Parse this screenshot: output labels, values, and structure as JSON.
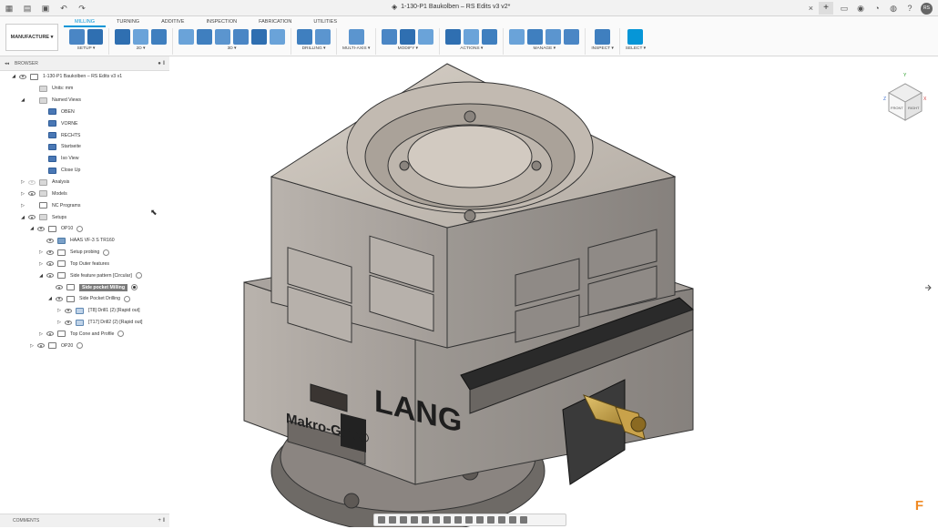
{
  "titlebar": {
    "document_title": "1-130-P1 Baukolben – RS Edits v3 v2*",
    "user_initials": "RS",
    "close_glyph": "×",
    "new_tab_glyph": "+"
  },
  "ribbon": {
    "workspace": "MANUFACTURE ▾",
    "tabs": [
      {
        "label": "MILLING",
        "active": true
      },
      {
        "label": "TURNING",
        "active": false
      },
      {
        "label": "ADDITIVE",
        "active": false
      },
      {
        "label": "INSPECTION",
        "active": false
      },
      {
        "label": "FABRICATION",
        "active": false
      },
      {
        "label": "UTILITIES",
        "active": false
      }
    ],
    "groups": [
      {
        "label": "SETUP ▾",
        "icons": 2
      },
      {
        "label": "2D ▾",
        "icons": 3
      },
      {
        "label": "3D ▾",
        "icons": 6
      },
      {
        "label": "DRILLING ▾",
        "icons": 2
      },
      {
        "label": "MULTI-AXIS ▾",
        "icons": 1
      },
      {
        "label": "MODIFY ▾",
        "icons": 3
      },
      {
        "label": "ACTIONS ▾",
        "icons": 3
      },
      {
        "label": "MANAGE ▾",
        "icons": 4
      },
      {
        "label": "INSPECT ▾",
        "icons": 1
      },
      {
        "label": "SELECT ▾",
        "icons": 1
      }
    ]
  },
  "browser": {
    "title": "BROWSER",
    "items": [
      {
        "label": "1-130-P1 Baukolben – RS Edits v3 v1",
        "indent": 0,
        "arrow": "◢",
        "eye": true,
        "icon": "setup"
      },
      {
        "label": "Units: mm",
        "indent": 1,
        "arrow": "",
        "eye": false,
        "icon": "folder"
      },
      {
        "label": "Named Views",
        "indent": 1,
        "arrow": "◢",
        "eye": false,
        "icon": "folder"
      },
      {
        "label": "OBEN",
        "indent": 2,
        "arrow": "",
        "eye": false,
        "icon": "view"
      },
      {
        "label": "VORNE",
        "indent": 2,
        "arrow": "",
        "eye": false,
        "icon": "view"
      },
      {
        "label": "RECHTS",
        "indent": 2,
        "arrow": "",
        "eye": false,
        "icon": "view"
      },
      {
        "label": "Startseite",
        "indent": 2,
        "arrow": "",
        "eye": false,
        "icon": "view"
      },
      {
        "label": "Iso View",
        "indent": 2,
        "arrow": "",
        "eye": false,
        "icon": "view"
      },
      {
        "label": "Close Up",
        "indent": 2,
        "arrow": "",
        "eye": false,
        "icon": "view"
      },
      {
        "label": "Analysis",
        "indent": 1,
        "arrow": "▷",
        "eye": "dim",
        "icon": "folder"
      },
      {
        "label": "Models",
        "indent": 1,
        "arrow": "▷",
        "eye": true,
        "icon": "folder"
      },
      {
        "label": "NC Programs",
        "indent": 1,
        "arrow": "▷",
        "eye": false,
        "icon": "setup"
      },
      {
        "label": "Setups",
        "indent": 1,
        "arrow": "◢",
        "eye": true,
        "icon": "folder"
      },
      {
        "label": "OP10",
        "indent": 2,
        "arrow": "◢",
        "eye": true,
        "icon": "setup",
        "circle": "off"
      },
      {
        "label": "HAAS VF-3 S TR160",
        "indent": 3,
        "arrow": "",
        "eye": true,
        "icon": "machine"
      },
      {
        "label": "Setup probing",
        "indent": 3,
        "arrow": "▷",
        "eye": true,
        "icon": "setup",
        "circle": "off"
      },
      {
        "label": "Top Outer features",
        "indent": 3,
        "arrow": "▷",
        "eye": true,
        "icon": "setup"
      },
      {
        "label": "Side feature pattern [Circular]",
        "indent": 3,
        "arrow": "◢",
        "eye": true,
        "icon": "setup",
        "circle": "off"
      },
      {
        "label": "Side pocket Milling",
        "indent": 4,
        "arrow": "",
        "eye": true,
        "icon": "setup",
        "circle": "on",
        "highlight": true
      },
      {
        "label": "Side Pocket Drilling",
        "indent": 4,
        "arrow": "◢",
        "eye": true,
        "icon": "setup",
        "circle": "off"
      },
      {
        "label": "[T8] Drill1 (2) [Rapid out]",
        "indent": 5,
        "arrow": "▷",
        "eye": true,
        "icon": "drill"
      },
      {
        "label": "[T17] Drill2 (2) [Rapid out]",
        "indent": 5,
        "arrow": "▷",
        "eye": true,
        "icon": "drill"
      },
      {
        "label": "Top Cone and Profile",
        "indent": 3,
        "arrow": "▷",
        "eye": true,
        "icon": "setup",
        "circle": "off"
      },
      {
        "label": "OP20",
        "indent": 2,
        "arrow": "▷",
        "eye": true,
        "icon": "setup",
        "circle": "off"
      }
    ]
  },
  "comments": {
    "title": "COMMENTS"
  },
  "model": {
    "brand_logo": "LANG",
    "product_text": "Makro-Grip®"
  },
  "viewcube": {
    "front_label": "FRONT",
    "right_label": "RIGHT",
    "axis_x": "X",
    "axis_y": "Y",
    "axis_z": "Z"
  },
  "colors": {
    "accent": "#0696d7",
    "vise_body": "#8f8a86",
    "model_top": "#c7bfb6",
    "brass": "#c9a24a",
    "fusion_orange": "#f08a24"
  }
}
